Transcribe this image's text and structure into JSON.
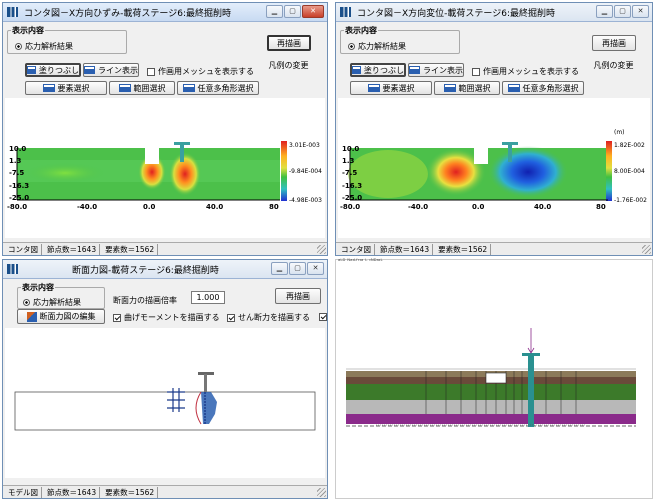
{
  "win1": {
    "title": "コンタ図－X方向ひずみ-載荷ステージ6:最終掘削時",
    "display_group": "表示内容",
    "radio_label": "応力解析結果",
    "redraw": "再描画",
    "legend_change": "凡例の変更",
    "fill_button": "塗りつぶし",
    "line_button": "ライン表示",
    "mesh_checkbox": "作画用メッシュを表示する",
    "select_element": "要素選択",
    "select_range": "範囲選択",
    "select_polygon": "任意多角形選択",
    "legend_values": [
      "3.01E-003",
      "-9.84E-004",
      "-4.98E-003"
    ],
    "y_ticks": [
      "10.0",
      "1.3",
      "-7.5",
      "-16.3",
      "-25.0"
    ],
    "x_ticks": [
      "-80.0",
      "-40.0",
      "0.0",
      "40.0",
      "80"
    ],
    "status": [
      "コンタ図",
      "節点数＝1643",
      "要素数＝1562"
    ]
  },
  "win2": {
    "title": "コンタ図－X方向変位-載荷ステージ6:最終掘削時",
    "display_group": "表示内容",
    "radio_label": "応力解析結果",
    "redraw": "再描画",
    "legend_change": "凡例の変更",
    "fill_button": "塗りつぶし",
    "line_button": "ライン表示",
    "mesh_checkbox": "作画用メッシュを表示する",
    "select_element": "要素選択",
    "select_range": "範囲選択",
    "select_polygon": "任意多角形選択",
    "unit": "(m)",
    "legend_values": [
      "1.82E-002",
      "8.00E-004",
      "-1.76E-002"
    ],
    "y_ticks": [
      "10.0",
      "1.3",
      "-7.5",
      "-16.3",
      "-25.0"
    ],
    "x_ticks": [
      "-80.0",
      "-40.0",
      "0.0",
      "40.0",
      "80"
    ],
    "status": [
      "コンタ図",
      "節点数＝1643",
      "要素数＝1562"
    ]
  },
  "win3": {
    "title": "断面力図-載荷ステージ6:最終掘削時",
    "display_group": "表示内容",
    "radio_label": "応力解析結果",
    "scale_label": "断面力の描画倍率",
    "scale_value": "1.000",
    "redraw": "再描画",
    "edit_button": "断面力図の編集",
    "moment_checkbox": "曲げモーメントを描画する",
    "shear_checkbox": "せん断力を描画する",
    "status": [
      "モデル図",
      "節点数＝1643",
      "要素数＝1562"
    ]
  },
  "win4": {
    "header_text": "ᵃᴸᴰ ᴺᵃᶦᴸᶠʳᶦᵃ  ᴸ ᶦᴺᴰᵃᶦᴸ"
  },
  "colors": {
    "title_active": "#c8daf2",
    "close": "#c8402a",
    "contour_green": "#4cc04a",
    "contour_red": "#e02020",
    "contour_blue": "#2040d0"
  }
}
